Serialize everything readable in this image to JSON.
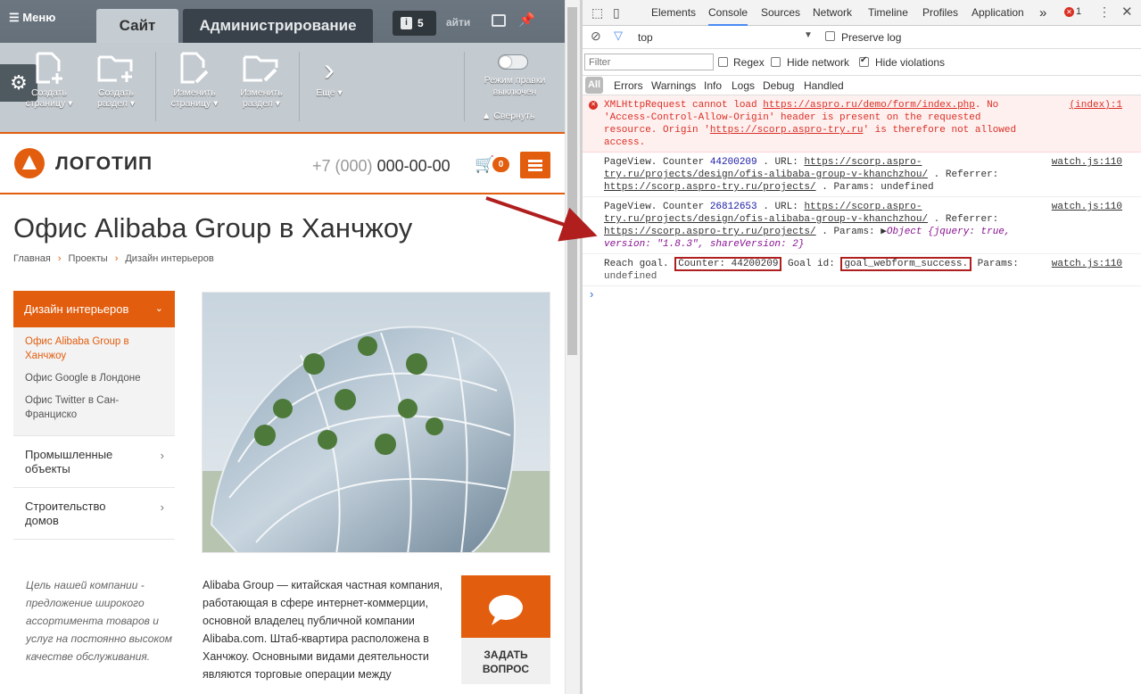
{
  "admin": {
    "menu_label": "Меню",
    "tab_site": "Сайт",
    "tab_admin": "Администрирование",
    "notifications_count": "5",
    "find_label": "айти",
    "tools": [
      {
        "icon": "add-page-icon",
        "label": "Создать страницу ▾"
      },
      {
        "icon": "add-folder-icon",
        "label": "Создать раздел ▾"
      },
      {
        "icon": "edit-page-icon",
        "label": "Изменить страницу ▾"
      },
      {
        "icon": "edit-folder-icon",
        "label": "Изменить раздел ▾"
      },
      {
        "icon": "chevron-right-icon",
        "label": "Еще ▾"
      }
    ],
    "edit_mode_label": "Режим правки выключен",
    "collapse_label": "Свернуть"
  },
  "site": {
    "logo": "ЛОГОТИП",
    "phone_code": "+7 (000)",
    "phone_number": "000-00-00",
    "cart_count": "0",
    "page_title": "Офис Alibaba Group в Ханчжоу",
    "breadcrumbs": [
      "Главная",
      "Проекты",
      "Дизайн интерьеров"
    ],
    "side_active": "Дизайн интерьеров",
    "side_sub": [
      "Офис Alibaba Group в Ханчжоу",
      "Офис Google в Лондоне",
      "Офис Twitter в Сан-Франциско"
    ],
    "side_items": [
      "Промышленные объекты",
      "Строительство домов"
    ],
    "quote": "Цель нашей компании - предложение широкого ассортимента товаров и услуг на постоянно высоком качестве обслуживания.",
    "paragraph": "Alibaba Group — китайская частная компания, работающая в сфере интернет-коммерции, основной владелец публичной компании Alibaba.com. Штаб-квартира расположена в Ханчжоу. Основными видами деятельности являются торговые операции между",
    "ask_label": "ЗАДАТЬ ВОПРОС"
  },
  "devtools": {
    "tabs": [
      "Elements",
      "Console",
      "Sources",
      "Network",
      "Timeline",
      "Profiles",
      "Application"
    ],
    "active_tab": "Console",
    "more": "»",
    "error_count": "1",
    "context": "top",
    "preserve_log": "Preserve log",
    "filter_placeholder": "Filter",
    "regex": "Regex",
    "hide_network": "Hide network",
    "hide_violations": "Hide violations",
    "levels": [
      "All",
      "Errors",
      "Warnings",
      "Info",
      "Logs",
      "Debug",
      "Handled"
    ],
    "logs": {
      "e1_pre": "XMLHttpRequest cannot load ",
      "e1_url": "https://aspro.ru/demo/form/index.php",
      "e1_mid": ". No 'Access-Control-Allow-Origin' header is present on the requested resource. Origin '",
      "e1_origin": "https://scorp.aspro-try.ru",
      "e1_post": "' is therefore not allowed access.",
      "e1_src": "(index):1",
      "l1_pre": "PageView. Counter ",
      "l1_num": "44200209",
      "l1_url_label": " . URL: ",
      "l1_url": "https://scorp.aspro-try.ru/projects/design/ofis-alibaba-group-v-khanchzhou/",
      "l1_ref_label": " . Referrer: ",
      "l1_ref": "https://scorp.aspro-try.ru/projects/",
      "l1_params": " . Params:  undefined",
      "l1_src": "watch.js:110",
      "l2_pre": "PageView. Counter ",
      "l2_num": "26812653",
      "l2_url_label": " . URL: ",
      "l2_url": "https://scorp.aspro-try.ru/projects/design/ofis-alibaba-group-v-khanchzhou/",
      "l2_ref_label": " . Referrer: ",
      "l2_ref": "https://scorp.aspro-try.ru/projects/",
      "l2_params": " . Params: ",
      "l2_obj": "Object {jquery: true, version: \"1.8.3\", shareVersion: 2}",
      "l2_src": "watch.js:110",
      "l3_pre": "Reach goal. ",
      "l3_counter": "Counter: 44200209",
      "l3_goal_label": " Goal id: ",
      "l3_goal": "goal_webform_success.",
      "l3_params": " Params:",
      "l3_undef": "undefined",
      "l3_src": "watch.js:110"
    }
  },
  "colors": {
    "accent": "#e25d0e",
    "highlight": "#b01e1e",
    "error": "#d93025"
  }
}
